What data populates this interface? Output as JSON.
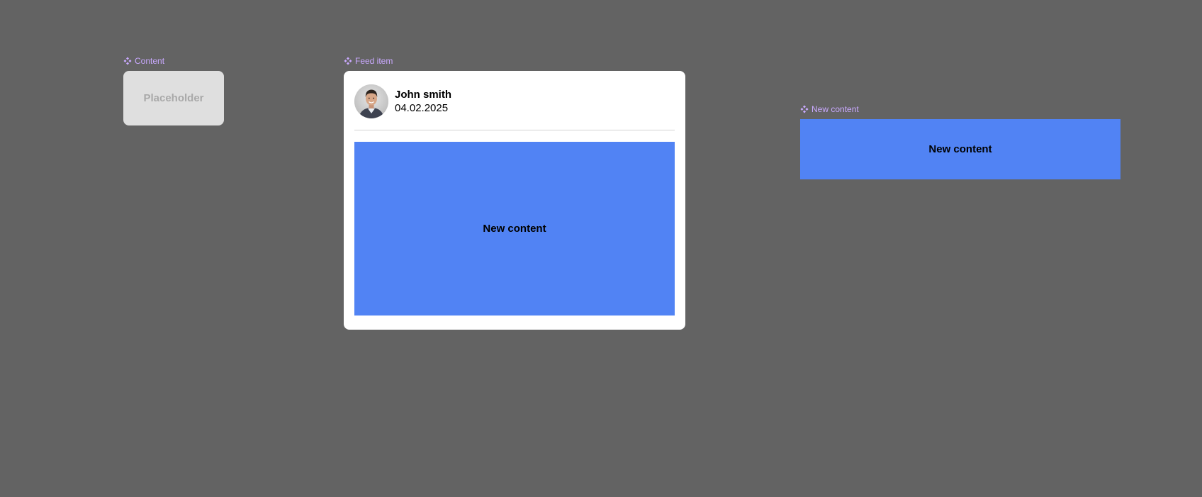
{
  "canvas": {
    "background": "#636363"
  },
  "components": {
    "content": {
      "label": "Content",
      "placeholder_text": "Placeholder",
      "fill": "#dfdfdf"
    },
    "feed_item": {
      "label": "Feed item",
      "user_name": "John smith",
      "date": "04.02.2025",
      "content_text": "New content",
      "card_fill": "#ffffff",
      "content_fill": "#5183f4"
    },
    "new_content": {
      "label": "New content",
      "text": "New content",
      "fill": "#5183f4"
    }
  },
  "icons": {
    "component_icon": "component-diamond-icon",
    "avatar": "user-photo"
  },
  "colors": {
    "component_label": "#c9a9ff"
  }
}
